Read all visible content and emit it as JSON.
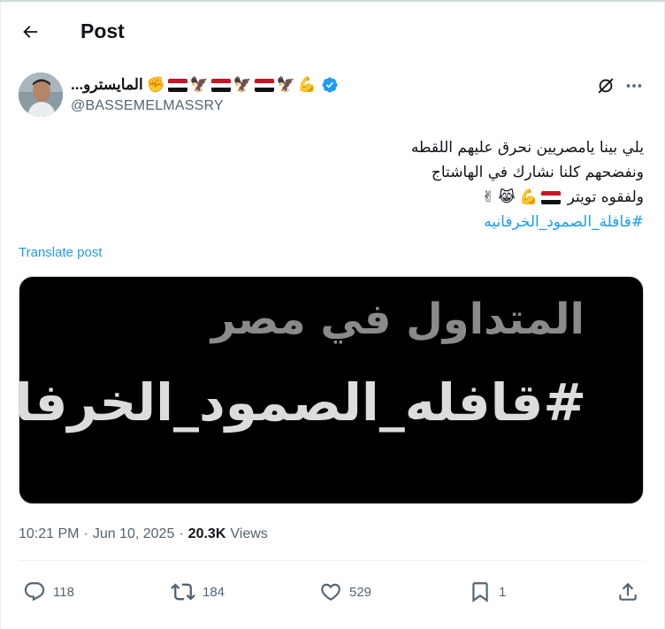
{
  "header": {
    "title": "Post"
  },
  "author": {
    "display_name": "...المايسترو",
    "handle": "@BASSEMELMASSRY",
    "verified": true
  },
  "tweet": {
    "lines": [
      "يلي بينا يامصريين نحرق عليهم اللقطه",
      "ونفضحهم كلنا نشارك في الهاشتاج",
      "ولفقوه تويتر"
    ],
    "hashtag": "#قافلة_الصمود_الخرفانيه"
  },
  "translate_label": "Translate post",
  "media": {
    "line1": "المتداول في مصر",
    "line2": "#قافله_الصمود_الخرفانيه"
  },
  "meta": {
    "time": "10:21 PM",
    "separator": "·",
    "date": "Jun 10, 2025",
    "separator2": "·",
    "views_count": "20.3K",
    "views_label": "Views"
  },
  "actions": {
    "replies": "118",
    "reposts": "184",
    "likes": "529",
    "bookmarks": "1"
  },
  "colors": {
    "accent": "#1d9bf0",
    "text": "#0f1419",
    "secondary": "#536471"
  }
}
